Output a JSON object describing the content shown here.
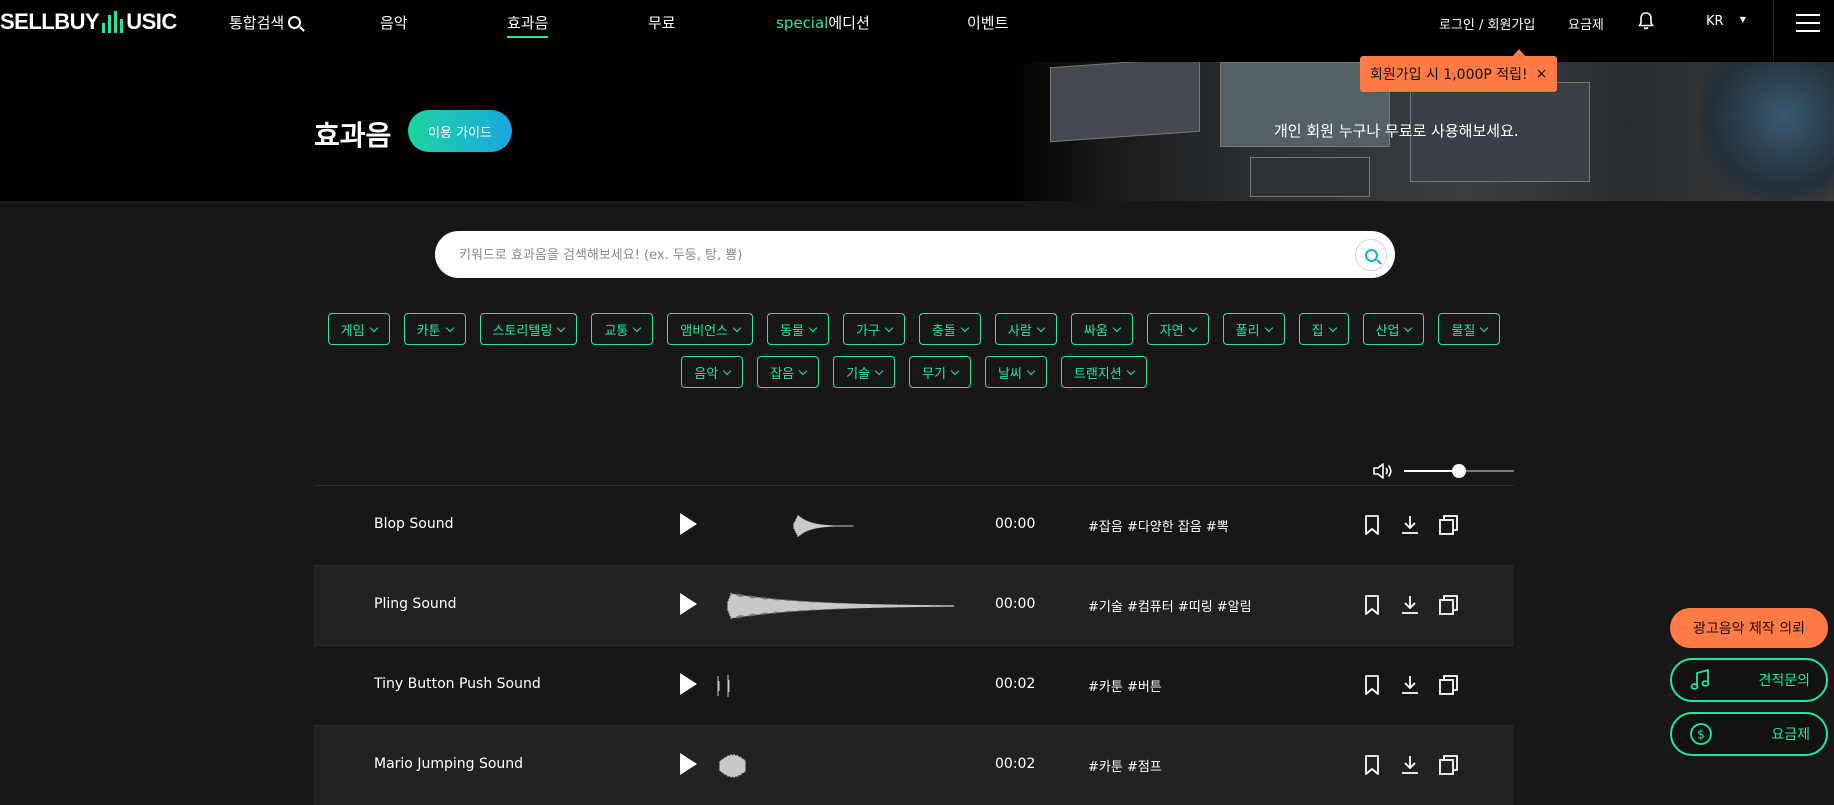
{
  "header": {
    "logo_left": "SELLBUY",
    "logo_right": "USIC",
    "nav": [
      {
        "label": "통합검색"
      },
      {
        "label": "음악"
      },
      {
        "label": "효과음"
      },
      {
        "label": "무료"
      },
      {
        "label_accent": "special",
        "label": "에디션"
      },
      {
        "label": "이벤트"
      }
    ],
    "login": "로그인 / 회원가입",
    "pricing": "요금제",
    "lang": "KR"
  },
  "tooltip": {
    "text": "회원가입 시 1,000P 적립!",
    "close": "×"
  },
  "hero": {
    "title": "효과음",
    "guide_button": "이용 가이드",
    "subtitle": "개인 회원 누구나 무료로 사용해보세요."
  },
  "search": {
    "placeholder": "키워드로 효과음을 검색해보세요! (ex. 두둥, 탕, 뿅)"
  },
  "categories": [
    "게임",
    "카툰",
    "스토리텔링",
    "교통",
    "앰비언스",
    "동물",
    "가구",
    "충돌",
    "사람",
    "싸움",
    "자연",
    "폴리",
    "집",
    "산업",
    "물질",
    "음악",
    "잡음",
    "기술",
    "무기",
    "날씨",
    "트랜지션"
  ],
  "volume": {
    "level": 0.5
  },
  "tracks": [
    {
      "name": "Blop Sound",
      "duration": "00:00",
      "tags": "#잡음 #다양한 잡음 #뽁"
    },
    {
      "name": "Pling Sound",
      "duration": "00:00",
      "tags": "#기술 #컴퓨터 #띠링 #알림"
    },
    {
      "name": "Tiny Button Push Sound",
      "duration": "00:02",
      "tags": "#카툰 #버튼"
    },
    {
      "name": "Mario Jumping Sound",
      "duration": "00:02",
      "tags": "#카툰 #점프"
    }
  ],
  "floating": {
    "ad_request": "광고음악 제작 의뢰",
    "quote": "견적문의",
    "pricing": "요금제"
  },
  "colors": {
    "accent": "#1de8a4",
    "orange": "#ff7a45",
    "background": "#171717"
  }
}
